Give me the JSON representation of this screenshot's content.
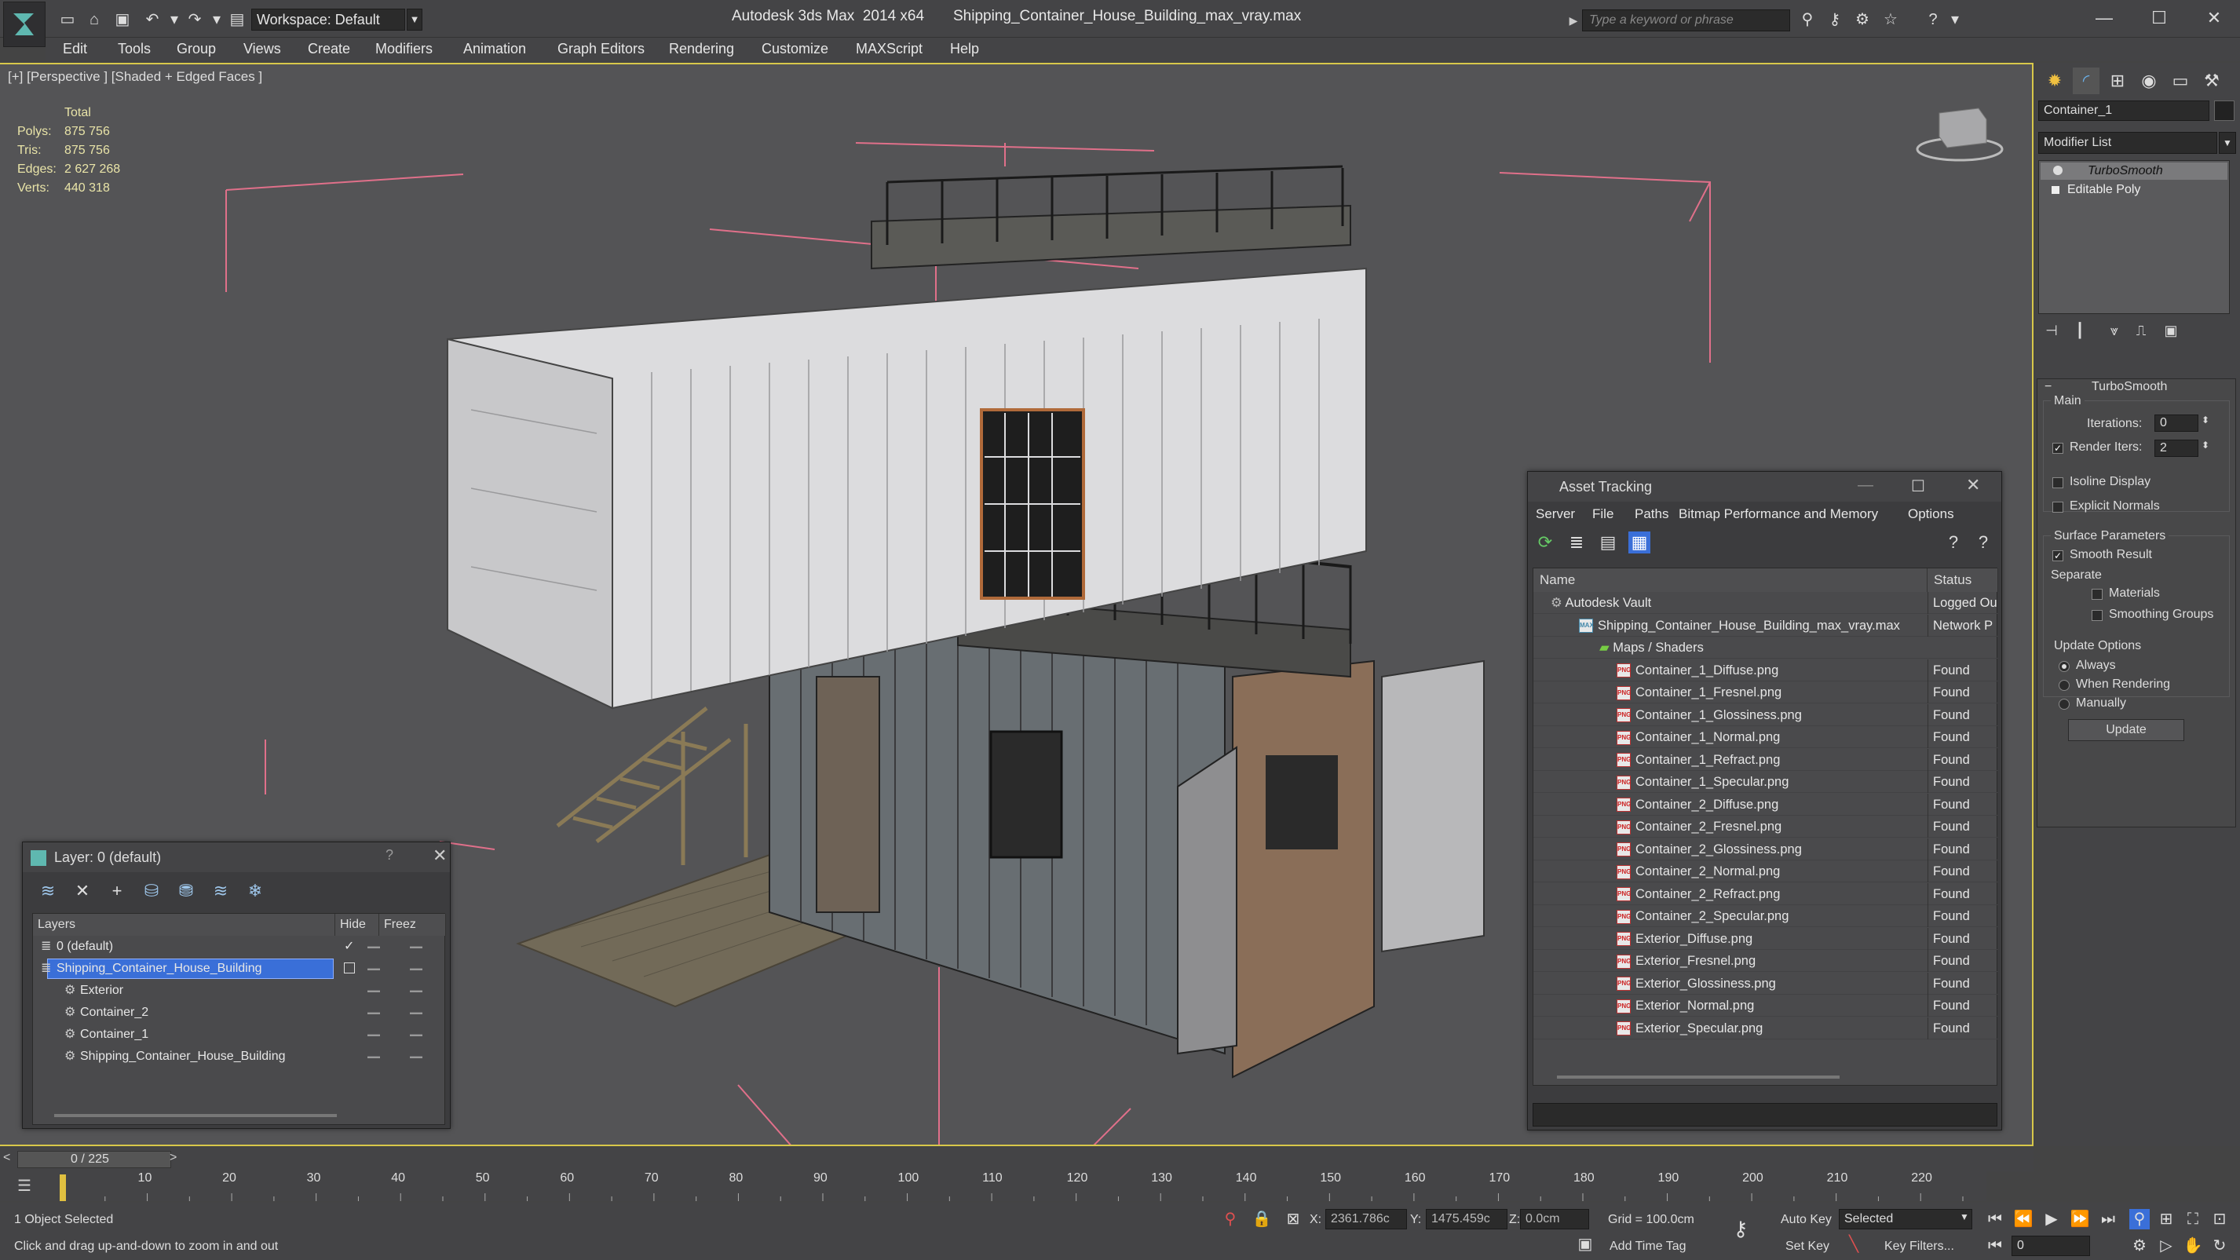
{
  "titlebar": {
    "workspace": "Workspace: Default",
    "app_title": "Autodesk 3ds Max  2014 x64       Shipping_Container_House_Building_max_vray.max",
    "search_placeholder": "Type a keyword or phrase"
  },
  "menu": [
    "Edit",
    "Tools",
    "Group",
    "Views",
    "Create",
    "Modifiers",
    "Animation",
    "Graph Editors",
    "Rendering",
    "Customize",
    "MAXScript",
    "Help"
  ],
  "viewport": {
    "label": "[+] [Perspective ] [Shaded + Edged Faces ]",
    "stats_header": "Total",
    "stats": [
      {
        "key": "Polys:",
        "value": "875 756"
      },
      {
        "key": "Tris:",
        "value": "875 756"
      },
      {
        "key": "Edges:",
        "value": "2 627 268"
      },
      {
        "key": "Verts:",
        "value": "440 318"
      }
    ]
  },
  "layer_explorer": {
    "title": "Layer: 0 (default)",
    "help": "?",
    "columns": [
      "Layers",
      "Hide",
      "Freez"
    ],
    "rows": [
      {
        "name": "0 (default)",
        "indent": 0,
        "selected": false
      },
      {
        "name": "Shipping_Container_House_Building",
        "indent": 0,
        "selected": true
      },
      {
        "name": "Exterior",
        "indent": 1,
        "selected": false
      },
      {
        "name": "Container_2",
        "indent": 1,
        "selected": false
      },
      {
        "name": "Container_1",
        "indent": 1,
        "selected": false
      },
      {
        "name": "Shipping_Container_House_Building",
        "indent": 1,
        "selected": false
      }
    ]
  },
  "asset_tracking": {
    "title": "Asset Tracking",
    "menu": [
      "Server",
      "File",
      "Paths",
      "Bitmap Performance and Memory",
      "Options"
    ],
    "columns": [
      "Name",
      "Status"
    ],
    "rows": [
      {
        "name": "Autodesk Vault",
        "status": "Logged Ou",
        "level": 0,
        "kind": "vault"
      },
      {
        "name": "Shipping_Container_House_Building_max_vray.max",
        "status": "Network P",
        "level": 1,
        "kind": "max"
      },
      {
        "name": "Maps / Shaders",
        "status": "",
        "level": 2,
        "kind": "folder"
      },
      {
        "name": "Container_1_Diffuse.png",
        "status": "Found",
        "level": 3,
        "kind": "png"
      },
      {
        "name": "Container_1_Fresnel.png",
        "status": "Found",
        "level": 3,
        "kind": "png"
      },
      {
        "name": "Container_1_Glossiness.png",
        "status": "Found",
        "level": 3,
        "kind": "png"
      },
      {
        "name": "Container_1_Normal.png",
        "status": "Found",
        "level": 3,
        "kind": "png"
      },
      {
        "name": "Container_1_Refract.png",
        "status": "Found",
        "level": 3,
        "kind": "png"
      },
      {
        "name": "Container_1_Specular.png",
        "status": "Found",
        "level": 3,
        "kind": "png"
      },
      {
        "name": "Container_2_Diffuse.png",
        "status": "Found",
        "level": 3,
        "kind": "png"
      },
      {
        "name": "Container_2_Fresnel.png",
        "status": "Found",
        "level": 3,
        "kind": "png"
      },
      {
        "name": "Container_2_Glossiness.png",
        "status": "Found",
        "level": 3,
        "kind": "png"
      },
      {
        "name": "Container_2_Normal.png",
        "status": "Found",
        "level": 3,
        "kind": "png"
      },
      {
        "name": "Container_2_Refract.png",
        "status": "Found",
        "level": 3,
        "kind": "png"
      },
      {
        "name": "Container_2_Specular.png",
        "status": "Found",
        "level": 3,
        "kind": "png"
      },
      {
        "name": "Exterior_Diffuse.png",
        "status": "Found",
        "level": 3,
        "kind": "png"
      },
      {
        "name": "Exterior_Fresnel.png",
        "status": "Found",
        "level": 3,
        "kind": "png"
      },
      {
        "name": "Exterior_Glossiness.png",
        "status": "Found",
        "level": 3,
        "kind": "png"
      },
      {
        "name": "Exterior_Normal.png",
        "status": "Found",
        "level": 3,
        "kind": "png"
      },
      {
        "name": "Exterior_Specular.png",
        "status": "Found",
        "level": 3,
        "kind": "png"
      }
    ]
  },
  "command_panel": {
    "object_name": "Container_1",
    "modifier_list": "Modifier List",
    "stack": [
      "TurboSmooth",
      "Editable Poly"
    ],
    "rollout_title": "TurboSmooth",
    "main_label": "Main",
    "iterations_label": "Iterations:",
    "iterations_value": "0",
    "render_iters_label": "Render Iters:",
    "render_iters_value": "2",
    "isoline_label": "Isoline Display",
    "explicit_normals_label": "Explicit Normals",
    "surface_params_label": "Surface Parameters",
    "smooth_result_label": "Smooth Result",
    "separate_label": "Separate",
    "materials_label": "Materials",
    "smoothing_groups_label": "Smoothing Groups",
    "update_options_label": "Update Options",
    "always_label": "Always",
    "when_rendering_label": "When Rendering",
    "manually_label": "Manually",
    "update_button": "Update"
  },
  "timeline": {
    "frame_counter": "0 / 225",
    "ticks": [
      "10",
      "20",
      "30",
      "40",
      "50",
      "60",
      "70",
      "80",
      "90",
      "100",
      "110",
      "120",
      "130",
      "140",
      "150",
      "160",
      "170",
      "180",
      "190",
      "200",
      "210",
      "220"
    ],
    "current_frame": 0,
    "total_frames": 225
  },
  "status": {
    "selection": "1 Object Selected",
    "prompt": "Click and drag up-and-down to zoom in and out",
    "x_label": "X:",
    "x_value": "2361.786c",
    "y_label": "Y:",
    "y_value": "1475.459c",
    "z_label": "Z:",
    "z_value": "0.0cm",
    "grid": "Grid = 100.0cm",
    "auto_key": "Auto Key",
    "selected_dropdown": "Selected",
    "set_key": "Set Key",
    "key_filters": "Key Filters...",
    "add_time_tag": "Add Time Tag",
    "frame_field": "0"
  },
  "colors": {
    "viewport_bg": "#545456",
    "viewport_border": "#d8c84a",
    "ui_bg": "#444446",
    "selection_blue": "#3a6fd8",
    "stats_yellow": "#e9e4a8"
  }
}
